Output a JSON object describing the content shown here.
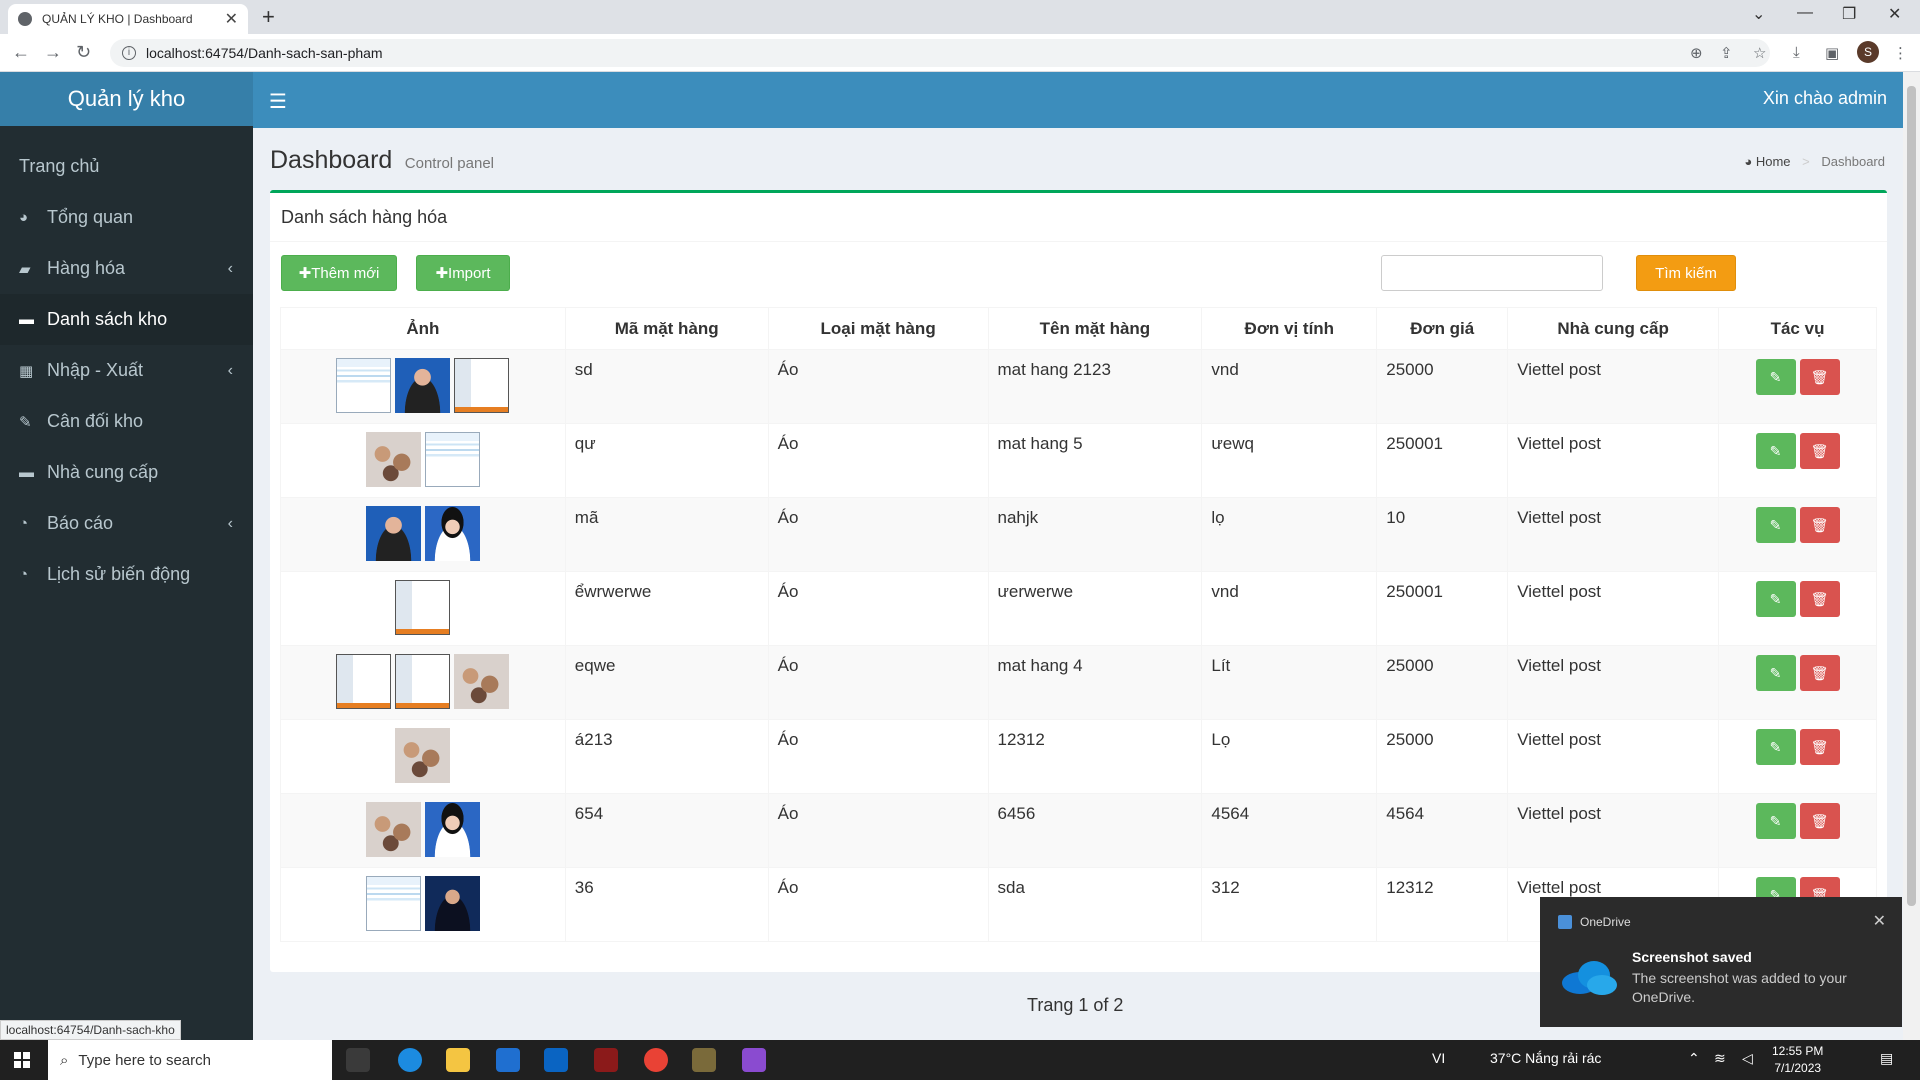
{
  "browser": {
    "tab_title": "QUẢN LÝ KHO | Dashboard",
    "url": "localhost:64754/Danh-sach-san-pham",
    "profile_initial": "S",
    "status_url": "localhost:64754/Danh-sach-kho"
  },
  "app": {
    "logo": "Quản lý kho",
    "greeting": "Xin chào admin"
  },
  "sidebar": {
    "items": [
      {
        "label": "Trang chủ",
        "icon": "none"
      },
      {
        "label": "Tổng quan",
        "icon": "dashboard-icon"
      },
      {
        "label": "Hàng hóa",
        "icon": "book-icon",
        "expandable": true
      },
      {
        "label": "Danh sách kho",
        "icon": "folder-icon",
        "active": true
      },
      {
        "label": "Nhập - Xuất",
        "icon": "grid-icon",
        "expandable": true
      },
      {
        "label": "Cân đối kho",
        "icon": "edit-icon"
      },
      {
        "label": "Nhà cung cấp",
        "icon": "folder-icon"
      },
      {
        "label": "Báo cáo",
        "icon": "pie-chart-icon",
        "expandable": true
      },
      {
        "label": "Lịch sử biến động",
        "icon": "pie-chart-icon"
      }
    ]
  },
  "header": {
    "title": "Dashboard",
    "subtitle": "Control panel",
    "breadcrumb_home": "Home",
    "breadcrumb_current": "Dashboard"
  },
  "box": {
    "title": "Danh sách hàng hóa",
    "add_label": "✚Thêm mới",
    "import_label": "✚Import",
    "search_label": "Tìm kiếm",
    "search_value": ""
  },
  "table": {
    "columns": [
      "Ảnh",
      "Mã mặt hàng",
      "Loại mặt hàng",
      "Tên mặt hàng",
      "Đơn vị tính",
      "Đơn giá",
      "Nhà cung cấp",
      "Tác vụ"
    ],
    "rows": [
      {
        "images": [
          "screen",
          "person",
          "screen2"
        ],
        "code": "sd",
        "type": "Áo",
        "name": "mat hang 2123",
        "unit": "vnd",
        "price": "25000",
        "supplier": "Viettel post"
      },
      {
        "images": [
          "hands",
          "screen"
        ],
        "code": "qư",
        "type": "Áo",
        "name": "mat hang 5",
        "unit": "ưewq",
        "price": "250001",
        "supplier": "Viettel post"
      },
      {
        "images": [
          "person",
          "woman"
        ],
        "code": "mã",
        "type": "Áo",
        "name": "nahjk",
        "unit": "lọ",
        "price": "10",
        "supplier": "Viettel post"
      },
      {
        "images": [
          "screen2"
        ],
        "code": "ểwrwerwe",
        "type": "Áo",
        "name": "ưerwerwe",
        "unit": "vnd",
        "price": "250001",
        "supplier": "Viettel post"
      },
      {
        "images": [
          "screen2",
          "screen2",
          "hands"
        ],
        "code": "eqwe",
        "type": "Áo",
        "name": "mat hang 4",
        "unit": "Lít",
        "price": "25000",
        "supplier": "Viettel post"
      },
      {
        "images": [
          "hands"
        ],
        "code": "á213",
        "type": "Áo",
        "name": "12312",
        "unit": "Lọ",
        "price": "25000",
        "supplier": "Viettel post"
      },
      {
        "images": [
          "hands",
          "woman"
        ],
        "code": "654",
        "type": "Áo",
        "name": "6456",
        "unit": "4564",
        "price": "4564",
        "supplier": "Viettel post"
      },
      {
        "images": [
          "screen",
          "dark"
        ],
        "code": "36",
        "type": "Áo",
        "name": "sda",
        "unit": "312",
        "price": "12312",
        "supplier": "Viettel post"
      }
    ]
  },
  "pagination": {
    "text": "Trang 1 of 2"
  },
  "toast": {
    "app": "OneDrive",
    "title": "Screenshot saved",
    "body": "The screenshot was added to your OneDrive."
  },
  "taskbar": {
    "search_placeholder": "Type here to search",
    "lang": "VI",
    "weather": "37°C  Nắng rải rác",
    "time": "12:55 PM",
    "date": "7/1/2023"
  },
  "colors": {
    "sidebar_bg": "#222d32",
    "topbar_bg": "#3c8dbc",
    "box_border": "#00a65a",
    "btn_success": "#5cb85c",
    "btn_warning": "#f39c12",
    "btn_danger": "#d9534f"
  }
}
